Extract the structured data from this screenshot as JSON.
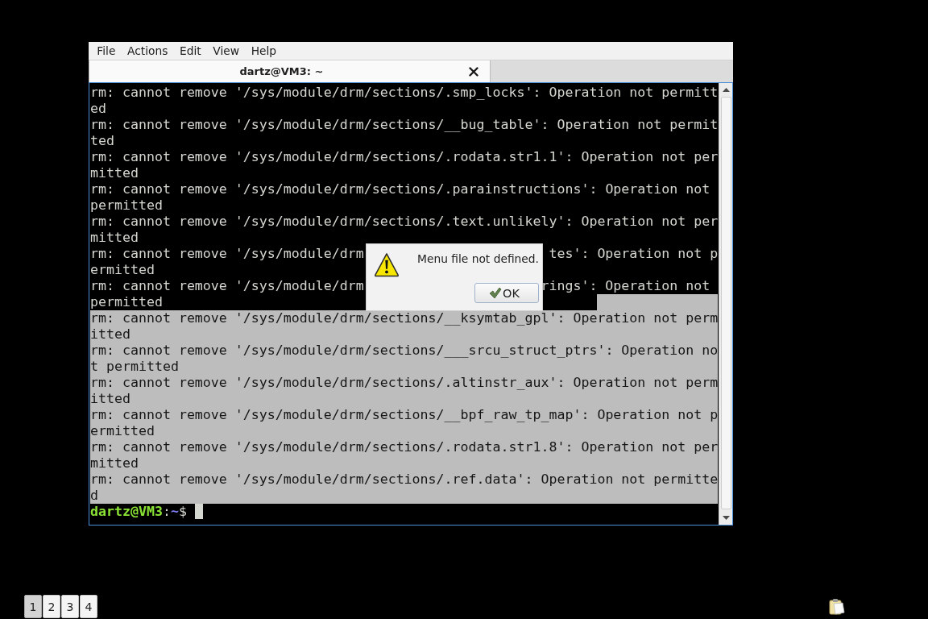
{
  "menu_bar": {
    "items": [
      "File",
      "Actions",
      "Edit",
      "View",
      "Help"
    ]
  },
  "tabs": [
    {
      "title": "dartz@VM3: ~",
      "selected": true
    }
  ],
  "terminal": {
    "rows": [
      {
        "text": "rm: cannot remove '/sys/module/drm/sections/.smp_locks': Operation not permitt",
        "selected": false,
        "selected_tail": false
      },
      {
        "text": "ed",
        "selected": false,
        "selected_tail": false
      },
      {
        "text": "rm: cannot remove '/sys/module/drm/sections/__bug_table': Operation not permit",
        "selected": false,
        "selected_tail": false
      },
      {
        "text": "ted",
        "selected": false,
        "selected_tail": false
      },
      {
        "text": "rm: cannot remove '/sys/module/drm/sections/.rodata.str1.1': Operation not per",
        "selected": false,
        "selected_tail": false
      },
      {
        "text": "mitted",
        "selected": false,
        "selected_tail": false
      },
      {
        "text": "rm: cannot remove '/sys/module/drm/sections/.parainstructions': Operation not",
        "selected": false,
        "selected_tail": false
      },
      {
        "text": "permitted",
        "selected": false,
        "selected_tail": false
      },
      {
        "text": "rm: cannot remove '/sys/module/drm/sections/.text.unlikely': Operation not per",
        "selected": false,
        "selected_tail": false
      },
      {
        "text": "mitted",
        "selected": false,
        "selected_tail": false
      },
      {
        "text": "rm: cannot remove '/sys/module/drm",
        "text_after_dialog": "tes': Operation not p",
        "selected": false,
        "selected_tail": false
      },
      {
        "text": "ermitted",
        "selected": false,
        "selected_tail": false
      },
      {
        "text": "rm: cannot remove '/sys/module/drm",
        "text_after_dialog": "rings': Operation not ",
        "selected": false,
        "selected_tail": false
      },
      {
        "text": "permitted",
        "selected": false,
        "selected_tail": true
      },
      {
        "text": "rm: cannot remove '/sys/module/drm/sections/__ksymtab_gpl': Operation not perm",
        "selected": true,
        "selected_tail": false
      },
      {
        "text": "itted",
        "selected": true,
        "selected_tail": false
      },
      {
        "text": "rm: cannot remove '/sys/module/drm/sections/___srcu_struct_ptrs': Operation no",
        "selected": true,
        "selected_tail": false
      },
      {
        "text": "t permitted",
        "selected": true,
        "selected_tail": false
      },
      {
        "text": "rm: cannot remove '/sys/module/drm/sections/.altinstr_aux': Operation not perm",
        "selected": true,
        "selected_tail": false
      },
      {
        "text": "itted",
        "selected": true,
        "selected_tail": false
      },
      {
        "text": "rm: cannot remove '/sys/module/drm/sections/__bpf_raw_tp_map': Operation not p",
        "selected": true,
        "selected_tail": false
      },
      {
        "text": "ermitted",
        "selected": true,
        "selected_tail": false
      },
      {
        "text": "rm: cannot remove '/sys/module/drm/sections/.rodata.str1.8': Operation not per",
        "selected": true,
        "selected_tail": false
      },
      {
        "text": "mitted",
        "selected": true,
        "selected_tail": false
      },
      {
        "text": "rm: cannot remove '/sys/module/drm/sections/.ref.data': Operation not permitte",
        "selected": true,
        "selected_tail": false
      },
      {
        "text": "d",
        "selected": true,
        "selected_tail": false
      }
    ],
    "prompt": {
      "user_host": "dartz@VM3",
      "separator": ":",
      "path": "~",
      "symbol": "$"
    }
  },
  "dialog": {
    "message": "Menu file not defined.",
    "button": "OK"
  },
  "workspaces": [
    {
      "label": "1",
      "selected": true
    },
    {
      "label": "2",
      "selected": false
    },
    {
      "label": "3",
      "selected": false
    },
    {
      "label": "4",
      "selected": false
    }
  ]
}
